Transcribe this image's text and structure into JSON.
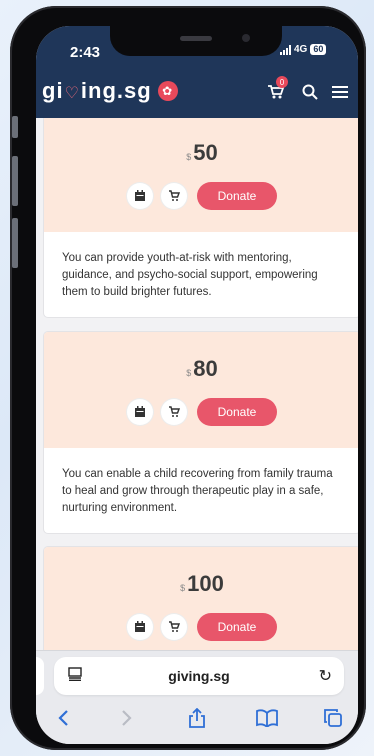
{
  "status": {
    "time": "2:43",
    "network": "4G",
    "battery": "60"
  },
  "header": {
    "logo_text": "giving.sg",
    "cart_count": "0"
  },
  "cards": [
    {
      "currency": "$",
      "amount": "50",
      "donate_label": "Donate",
      "description": "You can provide youth-at-risk with mentoring, guidance, and psycho-social support, empowering them to build brighter futures."
    },
    {
      "currency": "$",
      "amount": "80",
      "donate_label": "Donate",
      "description": "You can enable a child recovering from family trauma to heal and grow through therapeutic play in a safe, nurturing environment."
    },
    {
      "currency": "$",
      "amount": "100",
      "donate_label": "Donate",
      "description": ""
    }
  ],
  "browser": {
    "url": "giving.sg"
  },
  "colors": {
    "header_bg": "#1f3659",
    "accent": "#e8566a",
    "card_top": "#fde8dc",
    "link": "#2f6fd6"
  }
}
